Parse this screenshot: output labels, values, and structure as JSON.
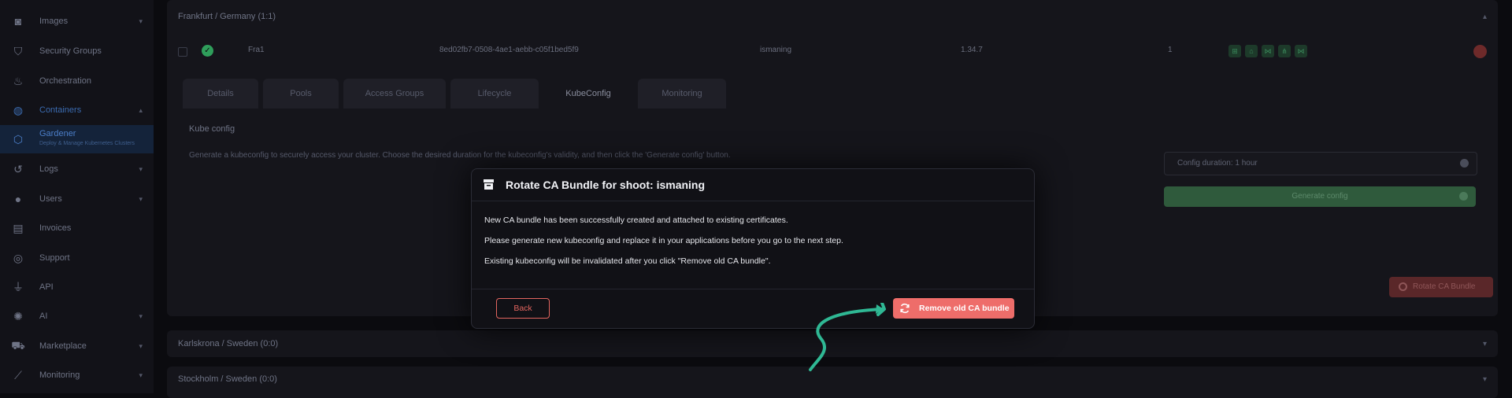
{
  "sidebar": {
    "items": [
      {
        "label": "Images",
        "icon": "camera-icon",
        "chevron": true
      },
      {
        "label": "Security Groups",
        "icon": "shield-icon",
        "chevron": false
      },
      {
        "label": "Orchestration",
        "icon": "flame-icon",
        "chevron": false
      },
      {
        "label": "Containers",
        "icon": "globe-icon",
        "chevron": true
      },
      {
        "label": "Gardener",
        "sub": "Deploy & Manage Kubernetes Clusters",
        "icon": "gardener-icon"
      },
      {
        "label": "Logs",
        "icon": "history-icon",
        "chevron": true
      },
      {
        "label": "Users",
        "icon": "user-icon",
        "chevron": true
      },
      {
        "label": "Invoices",
        "icon": "invoice-icon",
        "chevron": false
      },
      {
        "label": "Support",
        "icon": "lifebuoy-icon",
        "chevron": false
      },
      {
        "label": "API",
        "icon": "plug-icon",
        "chevron": false
      },
      {
        "label": "AI",
        "icon": "ai-icon",
        "chevron": true
      },
      {
        "label": "Marketplace",
        "icon": "cart-icon",
        "chevron": true
      },
      {
        "label": "Monitoring",
        "icon": "chart-icon",
        "chevron": true
      }
    ]
  },
  "regions": {
    "frankfurt": "Frankfurt / Germany (1:1)",
    "karlskrona": "Karlskrona / Sweden (0:0)",
    "stockholm": "Stockholm / Sweden (0:0)"
  },
  "cluster": {
    "name": "Fra1",
    "id": "8ed02fb7-0508-4ae1-aebb-c05f1bed5f9",
    "project": "ismaning",
    "version": "1.34.7",
    "count": "1"
  },
  "tabs": [
    "Details",
    "Pools",
    "Access Groups",
    "Lifecycle",
    "KubeConfig",
    "Monitoring"
  ],
  "kubeconfig": {
    "title": "Kube config",
    "description": "Generate a kubeconfig to securely access your cluster. Choose the desired duration for the kubeconfig's validity, and then click the 'Generate config' button.",
    "duration": "Config duration: 1 hour",
    "generate": "Generate config",
    "rotate": "Rotate CA Bundle"
  },
  "modal": {
    "title": "Rotate CA Bundle for shoot: ismaning",
    "line1": "New CA bundle has been successfully created and attached to existing certificates.",
    "line2": "Please generate new kubeconfig and replace it in your applications before you go to the next step.",
    "line3": "Existing kubeconfig will be invalidated after you click \"Remove old CA bundle\".",
    "back": "Back",
    "remove": "Remove old CA bundle"
  },
  "colors": {
    "accent_red": "#ee6d6a",
    "annotation_teal": "#2fb894",
    "status_green": "#2f9e5b"
  }
}
